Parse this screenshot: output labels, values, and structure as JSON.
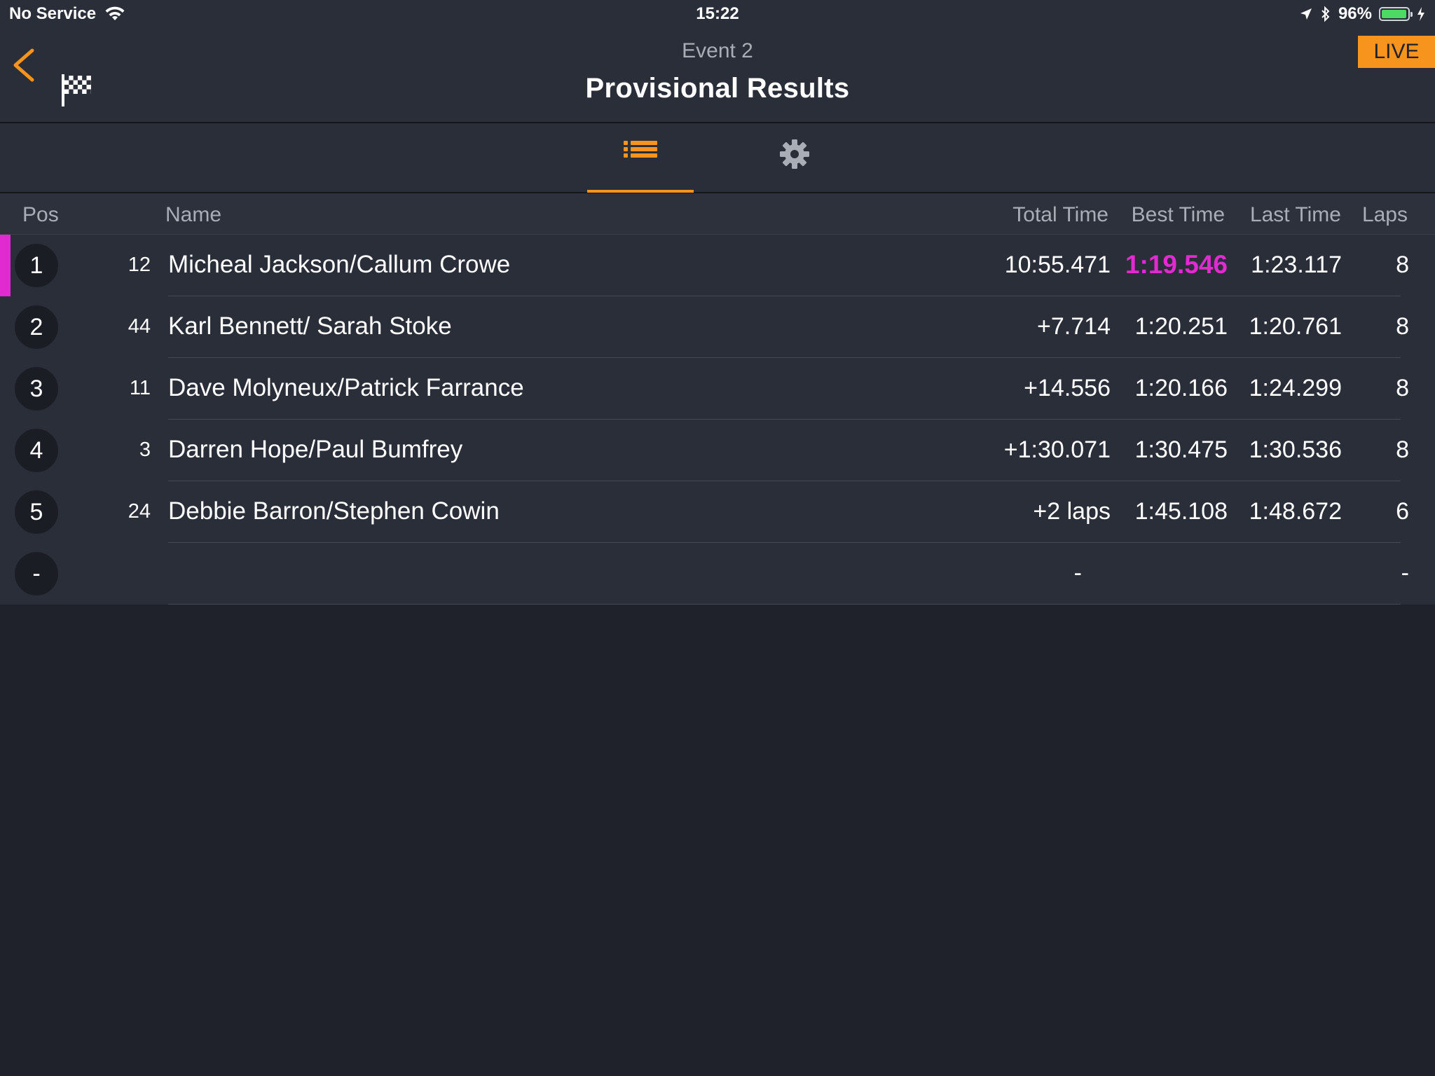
{
  "status_bar": {
    "carrier": "No Service",
    "time": "15:22",
    "battery": "96%",
    "battery_level": 0.96,
    "battery_color": "#4cd964"
  },
  "header": {
    "subtitle": "Event 2",
    "title": "Provisional Results",
    "live_label": "LIVE",
    "back_icon": "chevron-left-icon",
    "flag_icon": "checkered-flag-icon"
  },
  "tabs": [
    {
      "icon": "list-icon",
      "active": true
    },
    {
      "icon": "gear-icon",
      "active": false
    }
  ],
  "table": {
    "headers": {
      "pos": "Pos",
      "name": "Name",
      "total": "Total Time",
      "best": "Best Time",
      "last": "Last Time",
      "laps": "Laps"
    },
    "rows": [
      {
        "pos": "1",
        "num": "12",
        "name": "Micheal Jackson/Callum Crowe",
        "total": "10:55.471",
        "best": "1:19.546",
        "last": "1:23.117",
        "laps": "8"
      },
      {
        "pos": "2",
        "num": "44",
        "name": "Karl Bennett/ Sarah Stoke",
        "total": "+7.714",
        "best": "1:20.251",
        "last": "1:20.761",
        "laps": "8"
      },
      {
        "pos": "3",
        "num": "11",
        "name": "Dave Molyneux/Patrick Farrance",
        "total": "+14.556",
        "best": "1:20.166",
        "last": "1:24.299",
        "laps": "8"
      },
      {
        "pos": "4",
        "num": "3",
        "name": "Darren Hope/Paul Bumfrey",
        "total": "+1:30.071",
        "best": "1:30.475",
        "last": "1:30.536",
        "laps": "8"
      },
      {
        "pos": "5",
        "num": "24",
        "name": "Debbie Barron/Stephen Cowin",
        "total": "+2 laps",
        "best": "1:45.108",
        "last": "1:48.672",
        "laps": "6"
      },
      {
        "pos": "-",
        "num": "",
        "name": "",
        "total": "-",
        "best": "",
        "last": "",
        "laps": "-"
      }
    ]
  },
  "colors": {
    "accent": "#f7941d",
    "fastest_lap": "#e12bd0",
    "background": "#1f222b",
    "panel": "#2a2e38"
  }
}
